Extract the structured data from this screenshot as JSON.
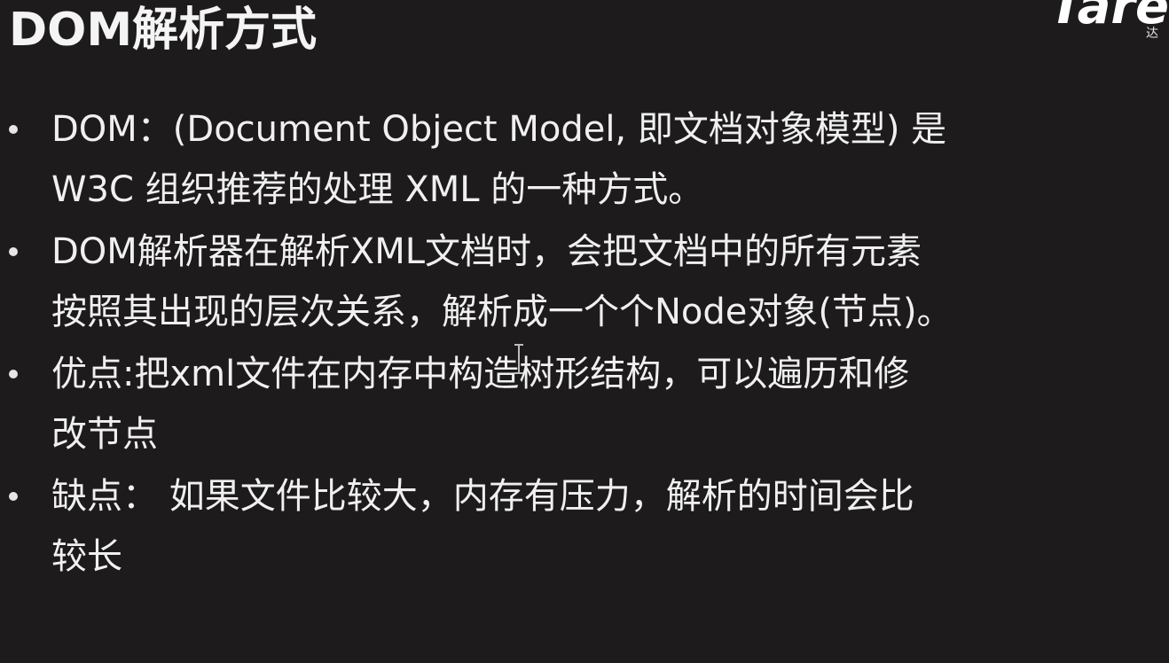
{
  "slide": {
    "title": "DOM解析方式",
    "logo_text": "Tare",
    "logo_subtext": "达",
    "bullets": [
      {
        "lines": [
          "DOM：(Document Object Model, 即文档对象模型) 是",
          "W3C 组织推荐的处理 XML 的一种方式。"
        ]
      },
      {
        "lines": [
          "DOM解析器在解析XML文档时，会把文档中的所有元素",
          "按照其出现的层次关系，解析成一个个Node对象(节点)。"
        ]
      },
      {
        "lines": [
          "优点:把xml文件在内存中构造树形结构，可以遍历和修",
          "改节点"
        ]
      },
      {
        "lines": [
          "缺点： 如果文件比较大，内存有压力，解析的时间会比",
          "较长"
        ]
      }
    ]
  },
  "icons": {
    "bullet": "bullet-dot-icon",
    "cursor": "text-cursor-icon"
  },
  "colors": {
    "background": "#1d1b1c",
    "text": "#f0f0f0"
  }
}
